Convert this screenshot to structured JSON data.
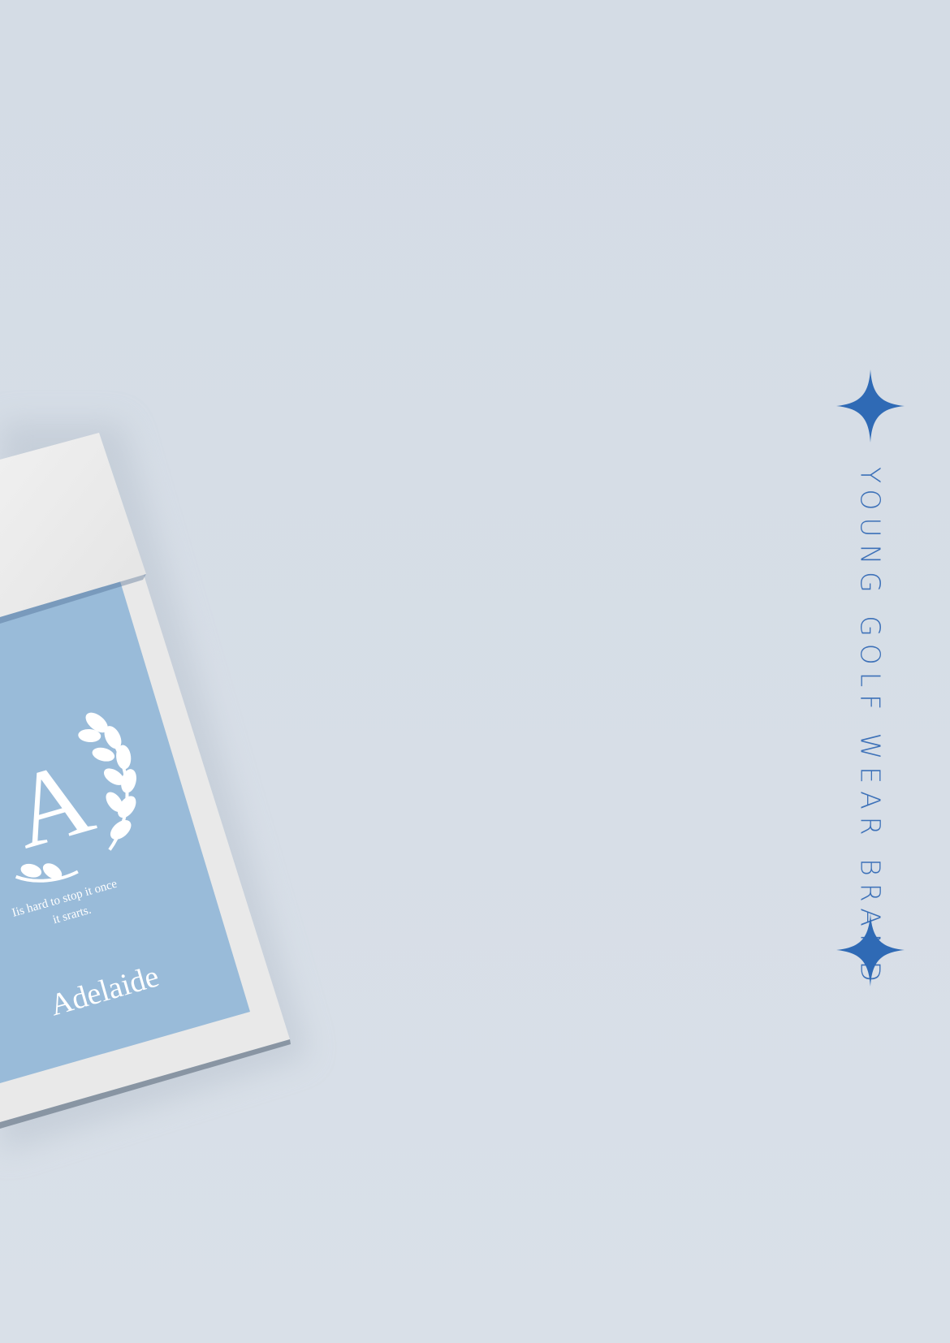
{
  "card": {
    "quote_line1": "Iis hard to stop it once",
    "quote_line2": "it srarts.",
    "brand_wordmark": "Adelaide",
    "monogram_letter": "A"
  },
  "side_banner": {
    "tagline": "YOUNG GOLF WEAR BRAND",
    "star_icon": "four-point-sparkle",
    "accent_color": "#2f6ab5"
  },
  "colors": {
    "background": "#d5dde6",
    "card_blue": "#99bbd9",
    "card_white": "#f0f0f0",
    "accent": "#2f6ab5"
  }
}
